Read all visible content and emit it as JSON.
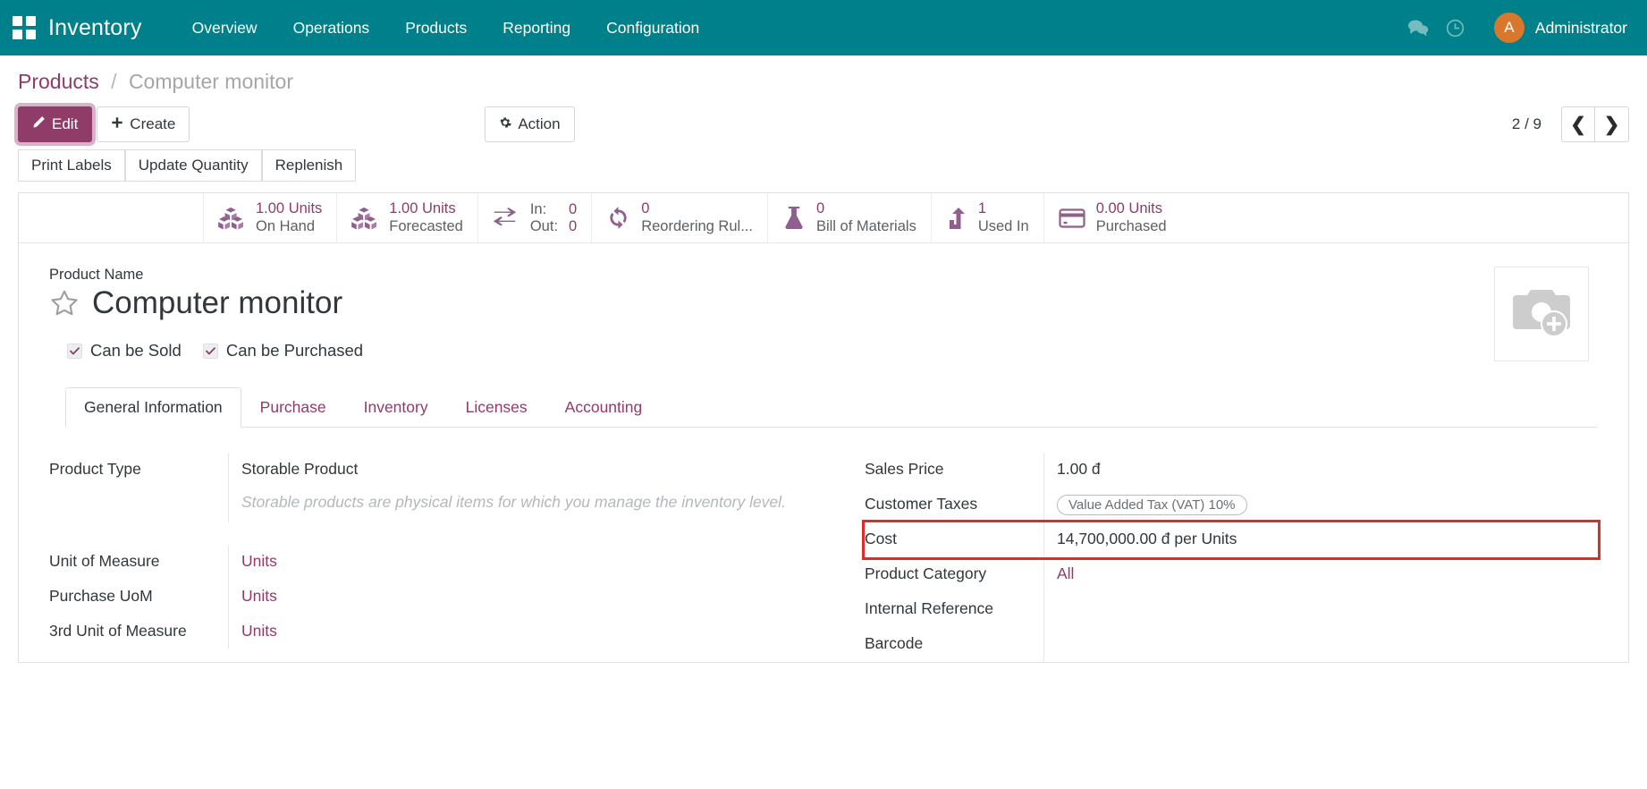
{
  "navbar": {
    "apps_icon": "apps-grid-icon",
    "brand": "Inventory",
    "menu": [
      "Overview",
      "Operations",
      "Products",
      "Reporting",
      "Configuration"
    ],
    "messages_icon": "messages-icon",
    "activities_icon": "clock-activities-icon",
    "avatar_initial": "A",
    "user_name": "Administrator",
    "bg_color": "#00808a",
    "avatar_color": "#d9782d"
  },
  "breadcrumb": {
    "parent": "Products",
    "separator": "/",
    "current": "Computer monitor"
  },
  "control_panel": {
    "edit_label": "Edit",
    "edit_icon": "pencil-icon",
    "create_label": "Create",
    "create_icon": "plus-icon",
    "action_label": "Action",
    "action_icon": "gear-icon",
    "pager_count": "2 / 9",
    "prev_icon": "chevron-left-icon",
    "next_icon": "chevron-right-icon",
    "secondary_buttons": [
      "Print Labels",
      "Update Quantity",
      "Replenish"
    ],
    "accent_color": "#8f3c69"
  },
  "stat_buttons": [
    {
      "icon": "boxes-icon",
      "value": "1.00 Units",
      "label": "On Hand"
    },
    {
      "icon": "boxes-icon",
      "value": "1.00 Units",
      "label": "Forecasted"
    },
    {
      "icon": "exchange-arrows-icon",
      "in_key": "In:",
      "in_value": "0",
      "out_key": "Out:",
      "out_value": "0"
    },
    {
      "icon": "refresh-icon",
      "value": "0",
      "label": "Reordering Rul..."
    },
    {
      "icon": "flask-icon",
      "value": "0",
      "label": "Bill of Materials"
    },
    {
      "icon": "arrow-up-branch-icon",
      "value": "1",
      "label": "Used In"
    },
    {
      "icon": "credit-card-icon",
      "value": "0.00 Units",
      "label": "Purchased"
    }
  ],
  "form": {
    "product_name_caption": "Product Name",
    "product_name": "Computer monitor",
    "favorite_icon": "star-outline-icon",
    "image_placeholder_icon": "camera-plus-icon",
    "checkboxes": [
      {
        "label": "Can be Sold",
        "checked": true
      },
      {
        "label": "Can be Purchased",
        "checked": true
      }
    ],
    "tabs": [
      {
        "label": "General Information",
        "active": true
      },
      {
        "label": "Purchase",
        "active": false
      },
      {
        "label": "Inventory",
        "active": false
      },
      {
        "label": "Licenses",
        "active": false
      },
      {
        "label": "Accounting",
        "active": false
      }
    ],
    "left_fields": [
      {
        "label": "Product Type",
        "value": "Storable Product",
        "kind": "text"
      },
      {
        "label": "",
        "value": "Storable products are physical items for which you manage the inventory level.",
        "kind": "hint"
      },
      {
        "label": "Unit of Measure",
        "value": "Units",
        "kind": "link"
      },
      {
        "label": "Purchase UoM",
        "value": "Units",
        "kind": "link"
      },
      {
        "label": "3rd Unit of Measure",
        "value": "Units",
        "kind": "link"
      }
    ],
    "right_fields": [
      {
        "label": "Sales Price",
        "value": "1.00 đ",
        "kind": "text"
      },
      {
        "label": "Customer Taxes",
        "value": "Value Added Tax (VAT) 10%",
        "kind": "tag"
      },
      {
        "label": "Cost",
        "value": "14,700,000.00 đ per Units",
        "kind": "text",
        "highlight": true
      },
      {
        "label": "Product Category",
        "value": "All",
        "kind": "link"
      },
      {
        "label": "Internal Reference",
        "value": "",
        "kind": "text"
      },
      {
        "label": "Barcode",
        "value": "",
        "kind": "text"
      }
    ],
    "highlight_color": "#e02b27"
  }
}
